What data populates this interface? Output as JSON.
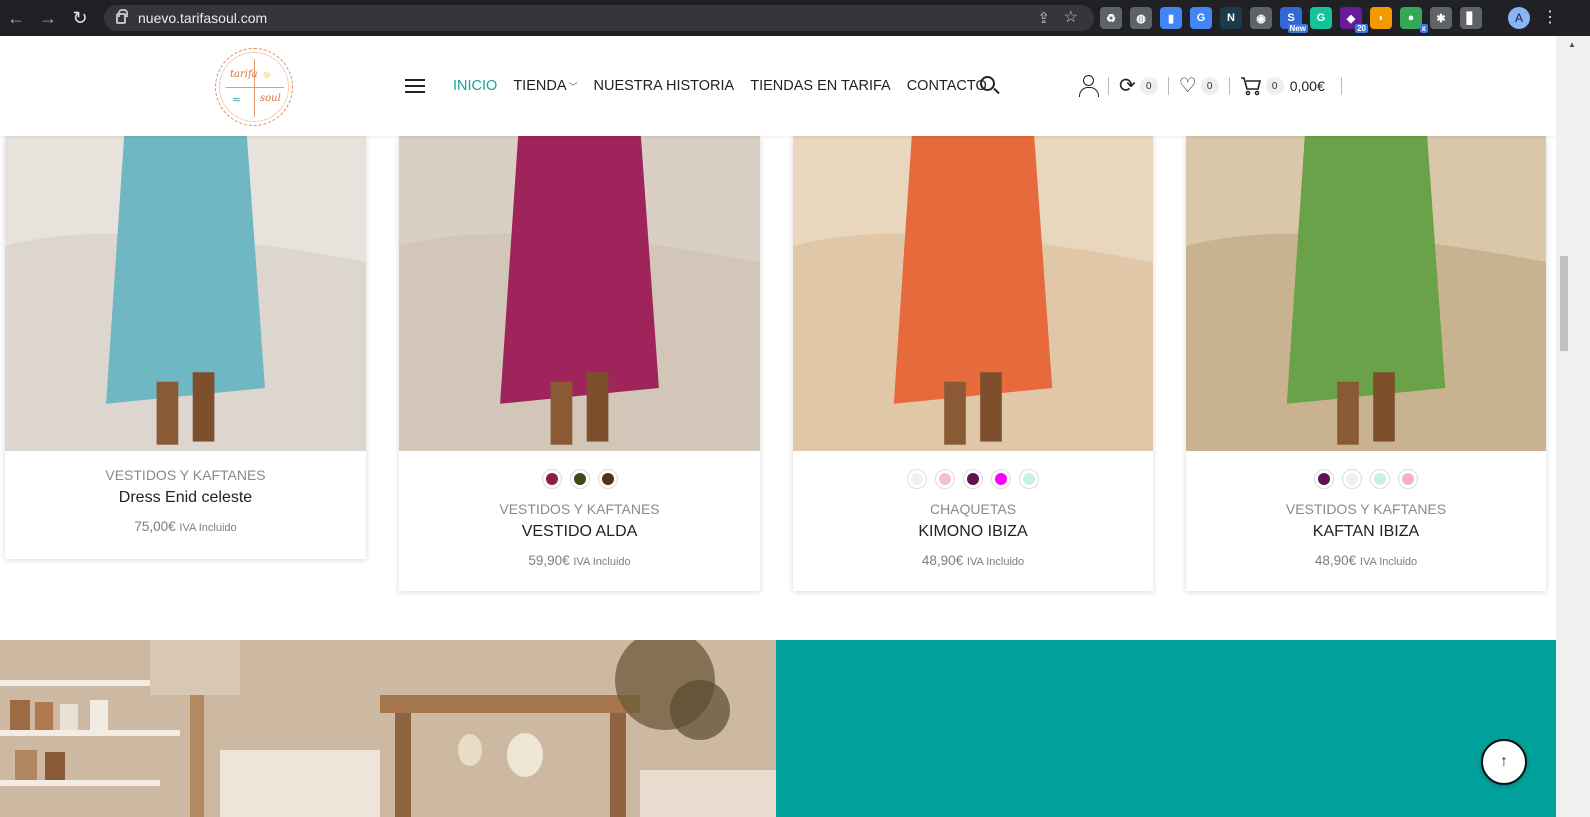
{
  "browser": {
    "url": "nuevo.tarifasoul.com",
    "extensions": [
      {
        "icon": "recycle-icon",
        "label": "♻",
        "color": "#5f6368"
      },
      {
        "icon": "globe-icon",
        "label": "◍",
        "color": "#5f6368"
      },
      {
        "icon": "docs-icon",
        "label": "▮",
        "color": "#4285f4"
      },
      {
        "icon": "translate-icon",
        "label": "G",
        "color": "#4285f4"
      },
      {
        "icon": "n-icon",
        "label": "N",
        "color": "#1b3a4b"
      },
      {
        "icon": "camera-icon",
        "label": "◉",
        "color": "#5f6368"
      },
      {
        "icon": "new-ext-icon",
        "label": "S",
        "color": "#3367d6",
        "badge": "New"
      },
      {
        "icon": "grammarly-icon",
        "label": "G",
        "color": "#15c39a"
      },
      {
        "icon": "hat-icon",
        "label": "◆",
        "color": "#6a1b9a",
        "badge": "20"
      },
      {
        "icon": "flame-icon",
        "label": "◗",
        "color": "#f29900"
      },
      {
        "icon": "globe-x-icon",
        "label": "●",
        "color": "#34a853",
        "badge": "x"
      },
      {
        "icon": "puzzle-icon",
        "label": "✱",
        "color": "#5f6368"
      },
      {
        "icon": "sidepanel-icon",
        "label": "▋",
        "color": "#5f6368"
      }
    ],
    "profile_initial": "A"
  },
  "header": {
    "logo_text_1": "tarifa",
    "logo_text_2": "soul",
    "nav": [
      {
        "label": "INICIO",
        "active": true
      },
      {
        "label": "TIENDA",
        "dropdown": true
      },
      {
        "label": "NUESTRA HISTORIA"
      },
      {
        "label": "TIENDAS EN TARIFA"
      },
      {
        "label": "CONTACTO"
      }
    ],
    "compare_count": "0",
    "wishlist_count": "0",
    "cart_count": "0",
    "cart_total": "0,00€"
  },
  "products": [
    {
      "category": "VESTIDOS Y KAFTANES",
      "name": "Dress Enid celeste",
      "price": "75,00€",
      "tax": "IVA Incluido",
      "swatches": [],
      "image_colors": [
        "#e7e2db",
        "#6fb7c3",
        "#d9d3cb"
      ]
    },
    {
      "category": "VESTIDOS Y KAFTANES",
      "name": "VESTIDO ALDA",
      "price": "59,90€",
      "tax": "IVA Incluido",
      "swatches": [
        "#8e1c4c",
        "#3d4a12",
        "#5a2e0e"
      ],
      "image_colors": [
        "#d9cfc4",
        "#a0245c",
        "#cfc3b5"
      ]
    },
    {
      "category": "CHAQUETAS",
      "name": "KIMONO IBIZA",
      "price": "48,90€",
      "tax": "IVA Incluido",
      "swatches": [
        "#f0f0f0",
        "#f3c0cc",
        "#5c1455",
        "#ff00ff",
        "#c8f2dc"
      ],
      "image_colors": [
        "#e8d6bd",
        "#e66a3c",
        "#dcc3a2"
      ]
    },
    {
      "category": "VESTIDOS Y KAFTANES",
      "name": "KAFTAN IBIZA",
      "price": "48,90€",
      "tax": "IVA Incluido",
      "swatches": [
        "#5c1455",
        "#f0f0f0",
        "#c8f2dc",
        "#f4b3c4"
      ],
      "image_colors": [
        "#d9c7a9",
        "#6aa24a",
        "#c4ad8a"
      ]
    }
  ],
  "accent_color": "#1aa39b",
  "section_teal": "#00a19b"
}
